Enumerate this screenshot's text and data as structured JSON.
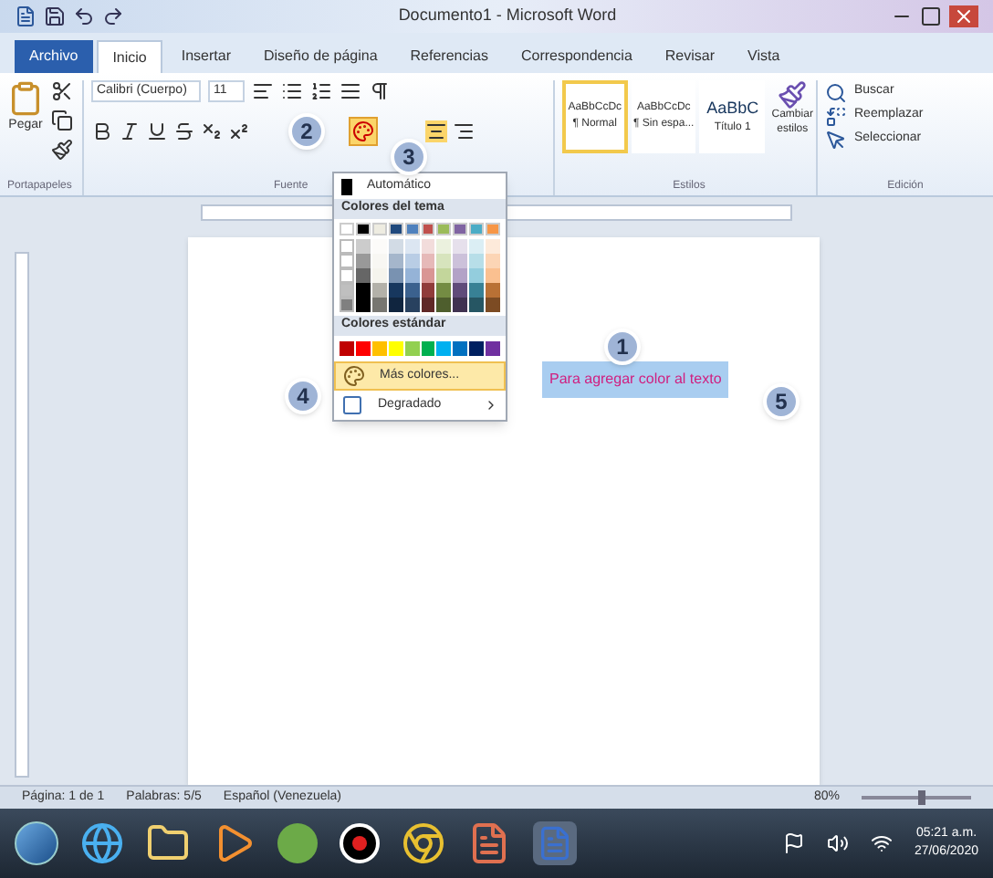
{
  "window": {
    "title": "Documento1 - Microsoft Word"
  },
  "tabs": [
    {
      "label": "Archivo",
      "kind": "file",
      "selected": false
    },
    {
      "label": "Inicio",
      "kind": "tab",
      "selected": true
    },
    {
      "label": "Insertar",
      "kind": "tab",
      "selected": false
    },
    {
      "label": "Diseño de página",
      "kind": "tab",
      "selected": false
    },
    {
      "label": "Referencias",
      "kind": "tab",
      "selected": false
    },
    {
      "label": "Correspondencia",
      "kind": "tab",
      "selected": false
    },
    {
      "label": "Revisar",
      "kind": "tab",
      "selected": false
    },
    {
      "label": "Vista",
      "kind": "tab",
      "selected": false
    }
  ],
  "ribbon": {
    "paste": "Pegar",
    "font_name": "Calibri (Cuerpo)",
    "font_size": "11",
    "styles": [
      {
        "sample": "AaBbCcDc",
        "name": "¶ Normal",
        "selected": true
      },
      {
        "sample": "AaBbCcDc",
        "name": "¶ Sin espa...",
        "selected": false
      },
      {
        "sample": "AaBbC",
        "name": "Título 1",
        "selected": false
      }
    ],
    "change_styles": "Cambiar estilos",
    "editing": [
      "Buscar",
      "Reemplazar",
      "Seleccionar"
    ],
    "groups": [
      "Portapapeles",
      "Fuente",
      "Estilos",
      "Edición"
    ]
  },
  "color_menu": {
    "automatic": "Automático",
    "theme_heading": "Colores del tema",
    "theme_colors": [
      {
        "color": "#ffffff"
      },
      {
        "color": "#000000"
      },
      {
        "color": "#eeece1"
      },
      {
        "color": "#1f497d"
      },
      {
        "color": "#4f81bd"
      },
      {
        "color": "#c0504d"
      },
      {
        "color": "#9bbb59"
      },
      {
        "color": "#8064a2"
      },
      {
        "color": "#4bacc6"
      },
      {
        "color": "#f79646"
      }
    ],
    "standard_heading": "Colores estándar",
    "standard_colors": [
      {
        "color": "#c00000"
      },
      {
        "color": "#ff0000"
      },
      {
        "color": "#ffc000"
      },
      {
        "color": "#ffff00"
      },
      {
        "color": "#92d050"
      },
      {
        "color": "#00b050"
      },
      {
        "color": "#00b0f0"
      },
      {
        "color": "#0070c0"
      },
      {
        "color": "#002060"
      },
      {
        "color": "#7030a0"
      }
    ],
    "more": "Más colores...",
    "gradient": "Degradado"
  },
  "document": {
    "text": "Para agregar color al texto"
  },
  "callouts": [
    "1",
    "2",
    "3",
    "4",
    "5"
  ],
  "status_bar": {
    "page": "Página: 1 de 1",
    "words": "Palabras: 5/5",
    "language": "Español (Venezuela)",
    "zoom": "80%",
    "zoom_slider": {
      "level": 0.55
    }
  },
  "taskbar": {
    "time": "05:21 a.m.",
    "date": "27/06/2020"
  }
}
